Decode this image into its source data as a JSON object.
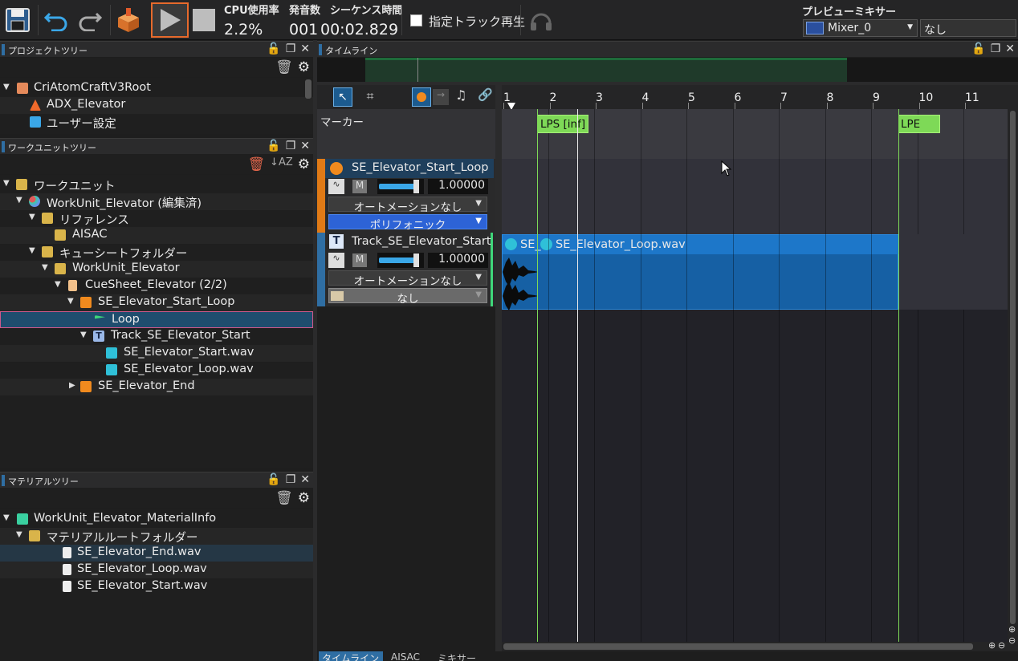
{
  "toolbar": {
    "cpu_label": "CPU使用率",
    "cpu_value": "2.2%",
    "voice_label": "発音数",
    "seq_time_label": "シーケンス時間",
    "voice_value": "001",
    "seq_time_value": "00:02.829",
    "specified_track_label": "指定トラック再生",
    "preview_mixer_label": "プレビューミキサー",
    "mixer_value": "Mixer_0",
    "mixer_other_value": "なし"
  },
  "project_tree": {
    "title": "プロジェクトツリー",
    "items": [
      {
        "label": "CriAtomCraftV3Root"
      },
      {
        "label": "ADX_Elevator"
      },
      {
        "label": "ユーザー設定"
      }
    ]
  },
  "workunit_tree": {
    "title": "ワークユニットツリー",
    "items": [
      {
        "label": "ワークユニット"
      },
      {
        "label": "WorkUnit_Elevator (編集済)"
      },
      {
        "label": "リファレンス"
      },
      {
        "label": "AISAC"
      },
      {
        "label": "キューシートフォルダー"
      },
      {
        "label": "WorkUnit_Elevator"
      },
      {
        "label": "CueSheet_Elevator (2/2)"
      },
      {
        "label": "SE_Elevator_Start_Loop"
      },
      {
        "label": "Loop"
      },
      {
        "label": "Track_SE_Elevator_Start"
      },
      {
        "label": "SE_Elevator_Start.wav"
      },
      {
        "label": "SE_Elevator_Loop.wav"
      },
      {
        "label": "SE_Elevator_End"
      }
    ]
  },
  "material_tree": {
    "title": "マテリアルツリー",
    "items": [
      {
        "label": "WorkUnit_Elevator_MaterialInfo"
      },
      {
        "label": "マテリアルルートフォルダー"
      },
      {
        "label": "SE_Elevator_End.wav"
      },
      {
        "label": "SE_Elevator_Loop.wav"
      },
      {
        "label": "SE_Elevator_Start.wav"
      }
    ]
  },
  "timeline": {
    "title": "タイムライン",
    "ruler": [
      "1",
      "2",
      "3",
      "4",
      "5",
      "6",
      "7",
      "8",
      "9",
      "10",
      "11"
    ],
    "marker_label": "マーカー",
    "markers": {
      "lps": "LPS [inf]",
      "lpe": "LPE"
    },
    "cue": {
      "name": "SE_Elevator_Start_Loop",
      "mute": "M",
      "volume": "1.00000",
      "automation": "オートメーションなし",
      "mode": "ポリフォニック"
    },
    "track": {
      "name": "Track_SE_Elevator_Start",
      "mute": "M",
      "volume": "1.00000",
      "automation": "オートメーションなし",
      "mode": "なし"
    },
    "waveform_labels": {
      "clip1": "SE_",
      "clip2": "SE_Elevator_Loop.wav"
    },
    "volume_level": 0.9
  },
  "bottom_tabs": [
    "タイムライン",
    "AISAC",
    "ミキサー"
  ],
  "colors": {
    "accent_blue": "#2f6ea3",
    "marker_green": "#7ed957",
    "clip_blue": "#1d77c9",
    "cue_orange": "#e07a16"
  }
}
